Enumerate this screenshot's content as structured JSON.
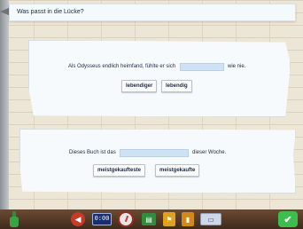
{
  "header": {
    "title": "Was passt in die Lücke?"
  },
  "exercises": [
    {
      "before": "Als Odysseus endlich heimfand, fühlte er sich",
      "after": "wie nie.",
      "choices": [
        "lebendiger",
        "lebendig"
      ]
    },
    {
      "before": "Dieses Buch ist das",
      "after": "dieser Woche.",
      "choices": [
        "meistgekaufteste",
        "meistgekaufte"
      ]
    }
  ],
  "toolbar": {
    "icons": [
      "bottle-icon",
      "back-icon",
      "timer-icon",
      "gauge-icon",
      "book-icon",
      "flag-icon",
      "bookmark-icon",
      "screen-icon",
      "check-icon"
    ],
    "timer_text": "0:00",
    "check_symbol": "✔"
  },
  "colors": {
    "gap_fill": "#cfe2f3",
    "toolbar_brown": "#5a3c27",
    "check_green": "#3bbf4c"
  }
}
